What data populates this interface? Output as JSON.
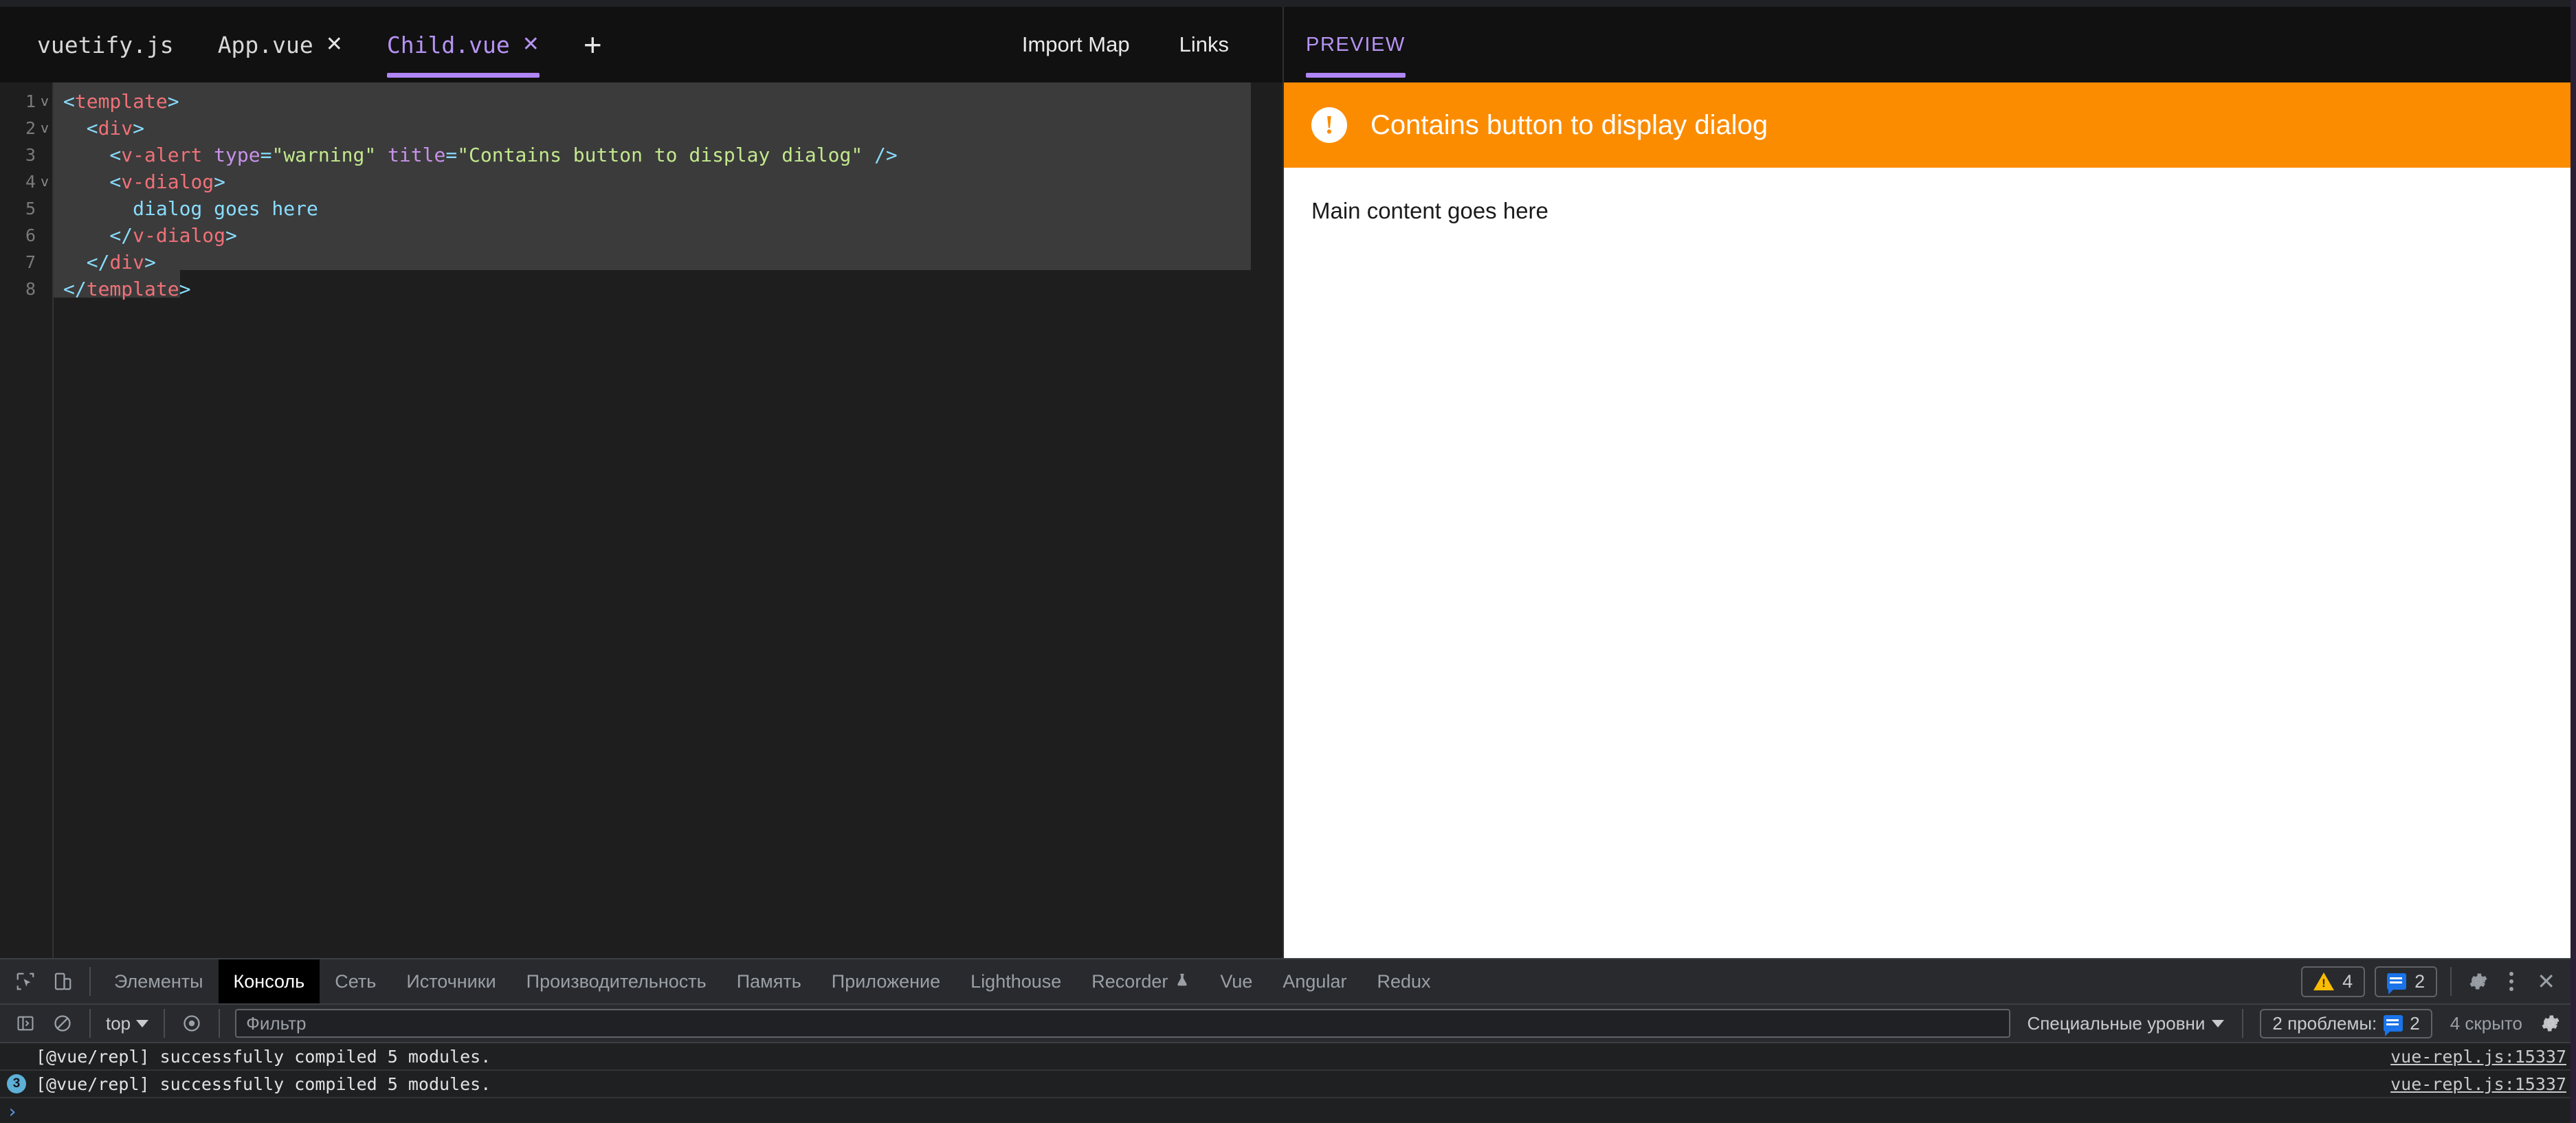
{
  "editor": {
    "tabs": [
      {
        "label": "vuetify.js",
        "closable": false,
        "active": false
      },
      {
        "label": "App.vue",
        "closable": true,
        "active": false
      },
      {
        "label": "Child.vue",
        "closable": true,
        "active": true
      }
    ],
    "add_tab_label": "+",
    "close_label": "✕",
    "actions": [
      {
        "label": "Import Map"
      },
      {
        "label": "Links"
      }
    ],
    "code_lines": [
      {
        "num": "1",
        "fold": "v",
        "tokens": [
          {
            "t": "<",
            "c": "tok-punct"
          },
          {
            "t": "template",
            "c": "tok-tag"
          },
          {
            "t": ">",
            "c": "tok-punct"
          }
        ]
      },
      {
        "num": "2",
        "fold": "v",
        "tokens": [
          {
            "t": "  <",
            "c": "tok-punct"
          },
          {
            "t": "div",
            "c": "tok-tag"
          },
          {
            "t": ">",
            "c": "tok-punct"
          }
        ]
      },
      {
        "num": "3",
        "fold": "",
        "tokens": [
          {
            "t": "    <",
            "c": "tok-punct"
          },
          {
            "t": "v-alert",
            "c": "tok-tag"
          },
          {
            "t": " type",
            "c": "tok-attr"
          },
          {
            "t": "=",
            "c": "tok-eq"
          },
          {
            "t": "\"warning\"",
            "c": "tok-str"
          },
          {
            "t": " title",
            "c": "tok-attr"
          },
          {
            "t": "=",
            "c": "tok-eq"
          },
          {
            "t": "\"Contains button to display dialog\"",
            "c": "tok-str"
          },
          {
            "t": " />",
            "c": "tok-punct"
          }
        ]
      },
      {
        "num": "4",
        "fold": "v",
        "tokens": [
          {
            "t": "    <",
            "c": "tok-punct"
          },
          {
            "t": "v-dialog",
            "c": "tok-tag"
          },
          {
            "t": ">",
            "c": "tok-punct"
          }
        ]
      },
      {
        "num": "5",
        "fold": "",
        "tokens": [
          {
            "t": "      dialog goes here",
            "c": "tok-text"
          }
        ]
      },
      {
        "num": "6",
        "fold": "",
        "tokens": [
          {
            "t": "    </",
            "c": "tok-punct"
          },
          {
            "t": "v-dialog",
            "c": "tok-tag"
          },
          {
            "t": ">",
            "c": "tok-punct"
          }
        ]
      },
      {
        "num": "7",
        "fold": "",
        "tokens": [
          {
            "t": "  </",
            "c": "tok-punct"
          },
          {
            "t": "div",
            "c": "tok-tag"
          },
          {
            "t": ">",
            "c": "tok-punct"
          }
        ]
      },
      {
        "num": "8",
        "fold": "",
        "tokens": [
          {
            "t": "</",
            "c": "tok-punct"
          },
          {
            "t": "template",
            "c": "tok-tag"
          },
          {
            "t": ">",
            "c": "tok-punct"
          }
        ]
      }
    ]
  },
  "preview": {
    "tab_label": "PREVIEW",
    "alert": {
      "icon": "exclamation-icon",
      "icon_glyph": "!",
      "title": "Contains button to display dialog",
      "color": "#fb8c00"
    },
    "body_text": "Main content goes here"
  },
  "devtools": {
    "tabs": [
      {
        "label": "Элементы",
        "active": false
      },
      {
        "label": "Консоль",
        "active": true
      },
      {
        "label": "Сеть",
        "active": false
      },
      {
        "label": "Источники",
        "active": false
      },
      {
        "label": "Производительность",
        "active": false
      },
      {
        "label": "Память",
        "active": false
      },
      {
        "label": "Приложение",
        "active": false
      },
      {
        "label": "Lighthouse",
        "active": false
      },
      {
        "label": "Recorder",
        "active": false,
        "icon": "flask-icon"
      },
      {
        "label": "Vue",
        "active": false
      },
      {
        "label": "Angular",
        "active": false
      },
      {
        "label": "Redux",
        "active": false
      }
    ],
    "warning_count": "4",
    "info_count": "2",
    "close_label": "✕",
    "filterbar": {
      "context": "top",
      "filter_placeholder": "Фильтр",
      "filter_value": "",
      "levels_label": "Специальные уровни",
      "issues_label": "2 проблемы:",
      "issues_count": "2",
      "hidden_label": "4 скрыто"
    },
    "console_rows": [
      {
        "badge": "",
        "message": "[@vue/repl] successfully compiled 5 modules.",
        "source": "vue-repl.js:15337"
      },
      {
        "badge": "3",
        "message": "[@vue/repl] successfully compiled 5 modules.",
        "source": "vue-repl.js:15337"
      }
    ],
    "prompt_chevron": "›"
  }
}
